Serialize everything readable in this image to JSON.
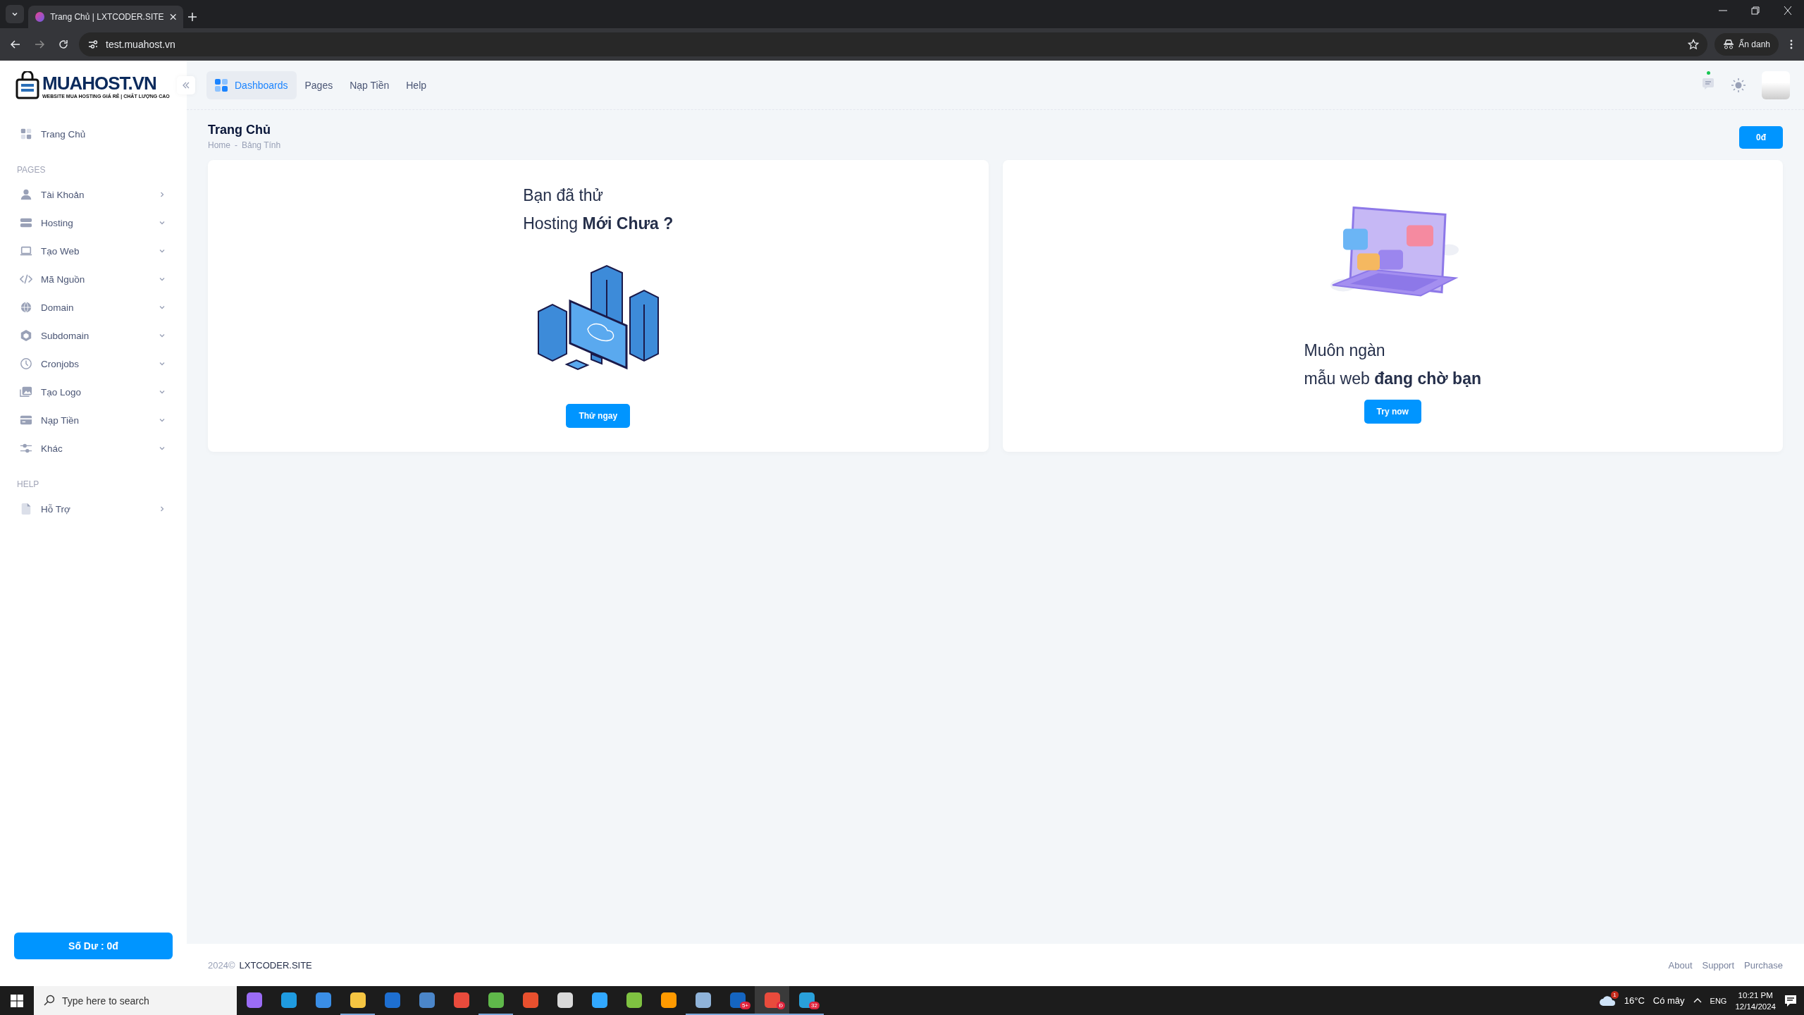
{
  "browser": {
    "tab_title": "Trang Chủ | LXTCODER.SITE",
    "url": "test.muahost.vn",
    "profile_label": "Ẩn danh"
  },
  "logo": {
    "name": "MUAHOST.VN",
    "tagline": "WEBSITE MUA HOSTING GIÁ RẺ | CHẤT LƯỢNG CAO"
  },
  "nav": [
    {
      "label": "Dashboards",
      "selected": true
    },
    {
      "label": "Pages",
      "selected": false
    },
    {
      "label": "Nạp Tiền",
      "selected": false
    },
    {
      "label": "Help",
      "selected": false
    }
  ],
  "sidebar": {
    "home": {
      "label": "Trang Chủ"
    },
    "sections": [
      {
        "heading": "PAGES",
        "items": [
          {
            "label": "Tài Khoản",
            "kind": "link"
          },
          {
            "label": "Hosting",
            "kind": "submenu"
          },
          {
            "label": "Tạo Web",
            "kind": "submenu"
          },
          {
            "label": "Mã Nguồn",
            "kind": "submenu"
          },
          {
            "label": "Domain",
            "kind": "submenu"
          },
          {
            "label": "Subdomain",
            "kind": "submenu"
          },
          {
            "label": "Cronjobs",
            "kind": "submenu"
          },
          {
            "label": "Tạo Logo",
            "kind": "submenu"
          },
          {
            "label": "Nạp Tiền",
            "kind": "submenu"
          },
          {
            "label": "Khác",
            "kind": "submenu"
          }
        ]
      },
      {
        "heading": "HELP",
        "items": [
          {
            "label": "Hỗ Trợ",
            "kind": "link"
          }
        ]
      }
    ],
    "balance_button": "Số Dư : 0đ"
  },
  "page": {
    "title": "Trang Chủ",
    "breadcrumb": [
      "Home",
      "Bảng Tính"
    ],
    "breadcrumb_separator": "-",
    "balance_badge": "0đ"
  },
  "cards": [
    {
      "kind": "servers",
      "lines": [
        "Bạn đã thử",
        "Hosting **Mới Chưa ?**"
      ],
      "button": "Thử ngay"
    },
    {
      "kind": "laptop",
      "lines": [
        "Muôn ngàn",
        "mẫu web **đang chờ bạn**"
      ],
      "button": "Try now"
    }
  ],
  "footer": {
    "year": "2024©",
    "site": "LXTCODER.SITE",
    "links": [
      "About",
      "Support",
      "Purchase"
    ]
  },
  "taskbar": {
    "search_placeholder": "Type here to search",
    "apps": [
      {
        "running": false,
        "selected": false
      },
      {
        "running": false,
        "selected": false
      },
      {
        "running": false,
        "selected": false
      },
      {
        "running": true,
        "selected": false
      },
      {
        "running": false,
        "selected": false
      },
      {
        "running": false,
        "selected": false
      },
      {
        "running": false,
        "selected": false
      },
      {
        "running": true,
        "selected": false
      },
      {
        "running": false,
        "selected": false
      },
      {
        "running": false,
        "selected": false
      },
      {
        "running": false,
        "selected": false
      },
      {
        "running": false,
        "selected": false
      },
      {
        "running": false,
        "selected": false
      },
      {
        "running": true,
        "selected": false
      },
      {
        "running": true,
        "selected": false,
        "badge": "5+"
      },
      {
        "running": true,
        "selected": true,
        "badge": "Đ"
      },
      {
        "running": true,
        "selected": false,
        "badge": "32"
      }
    ],
    "weather_badge": "1",
    "temperature": "16°C",
    "weather": "Có mây",
    "language": "ENG",
    "time": "10:21 PM",
    "date": "12/14/2024"
  }
}
